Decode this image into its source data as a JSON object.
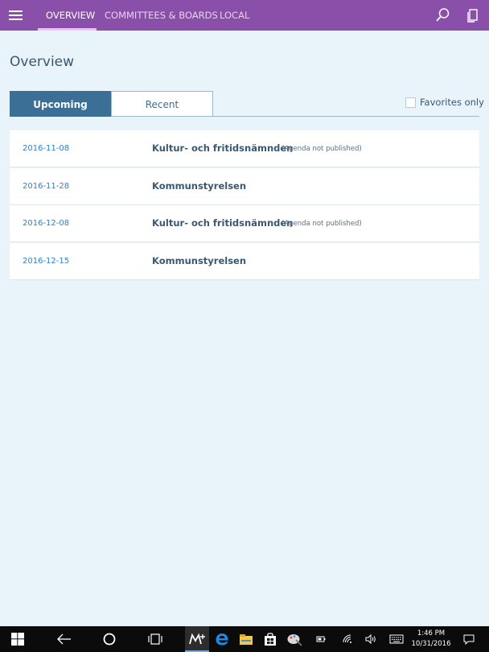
{
  "nav": {
    "tabs": [
      {
        "label": "OVERVIEW",
        "active": true
      },
      {
        "label": "COMMITTEES & BOARDS",
        "active": false
      },
      {
        "label": "LOCAL",
        "active": false
      }
    ],
    "icons": [
      "hamburger-menu-icon",
      "search-icon",
      "documents-icon"
    ],
    "accent_color": "#8a4fa8"
  },
  "page": {
    "title": "Overview"
  },
  "segments": {
    "upcoming": "Upcoming",
    "recent": "Recent",
    "selected": "Upcoming"
  },
  "favorites": {
    "label": "Favorites only",
    "checked": false
  },
  "meetings": [
    {
      "date": "2016-11-08",
      "name": "Kultur- och fritidsnämnden",
      "note": "(Agenda not published)"
    },
    {
      "date": "2016-11-28",
      "name": "Kommunstyrelsen",
      "note": ""
    },
    {
      "date": "2016-12-08",
      "name": "Kultur- och fritidsnämnden",
      "note": "(Agenda not published)"
    },
    {
      "date": "2016-12-15",
      "name": "Kommunstyrelsen",
      "note": ""
    }
  ],
  "taskbar": {
    "icons": [
      "windows-start-icon",
      "back-arrow-icon",
      "cortana-circle-icon",
      "task-view-icon",
      "meetings-app-icon",
      "edge-browser-icon",
      "file-explorer-icon",
      "store-icon",
      "paint-icon",
      "battery-icon",
      "wifi-icon",
      "volume-icon",
      "keyboard-icon",
      "notifications-icon"
    ],
    "time": "1:46 PM",
    "date": "10/31/2016"
  }
}
